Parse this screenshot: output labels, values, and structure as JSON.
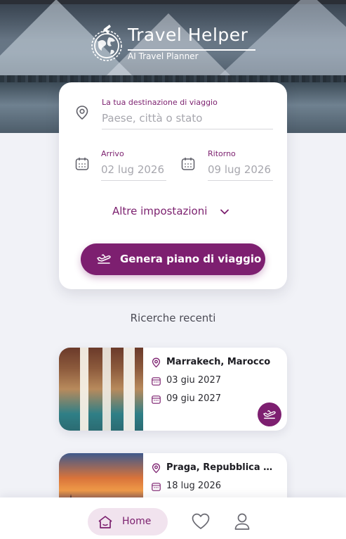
{
  "app": {
    "title": "Travel Helper",
    "subtitle": "AI Travel Planner"
  },
  "search": {
    "destination_label": "La tua destinazione di viaggio",
    "destination_placeholder": "Paese, città o stato",
    "arrival_label": "Arrivo",
    "arrival_value": "02 lug 2026",
    "return_label": "Ritorno",
    "return_value": "09 lug 2026",
    "more_settings_label": "Altre impostazioni",
    "generate_label": "Genera piano di viaggio"
  },
  "recent": {
    "heading": "Ricerche recenti",
    "items": [
      {
        "place": "Marrakech, Marocco",
        "start": "03 giu 2027",
        "end": "09 giu 2027"
      },
      {
        "place": "Praga, Repubblica Ceca",
        "start": "18 lug 2026",
        "end": ""
      }
    ]
  },
  "nav": {
    "home_label": "Home"
  },
  "colors": {
    "accent": "#7d1f70",
    "accent_light": "#f1e3ee",
    "background": "#f1f2f7"
  },
  "icons": [
    "globe-logo-icon",
    "location-pin-icon",
    "calendar-icon",
    "chevron-down-icon",
    "airplane-takeoff-icon",
    "home-icon",
    "heart-icon",
    "user-icon"
  ]
}
